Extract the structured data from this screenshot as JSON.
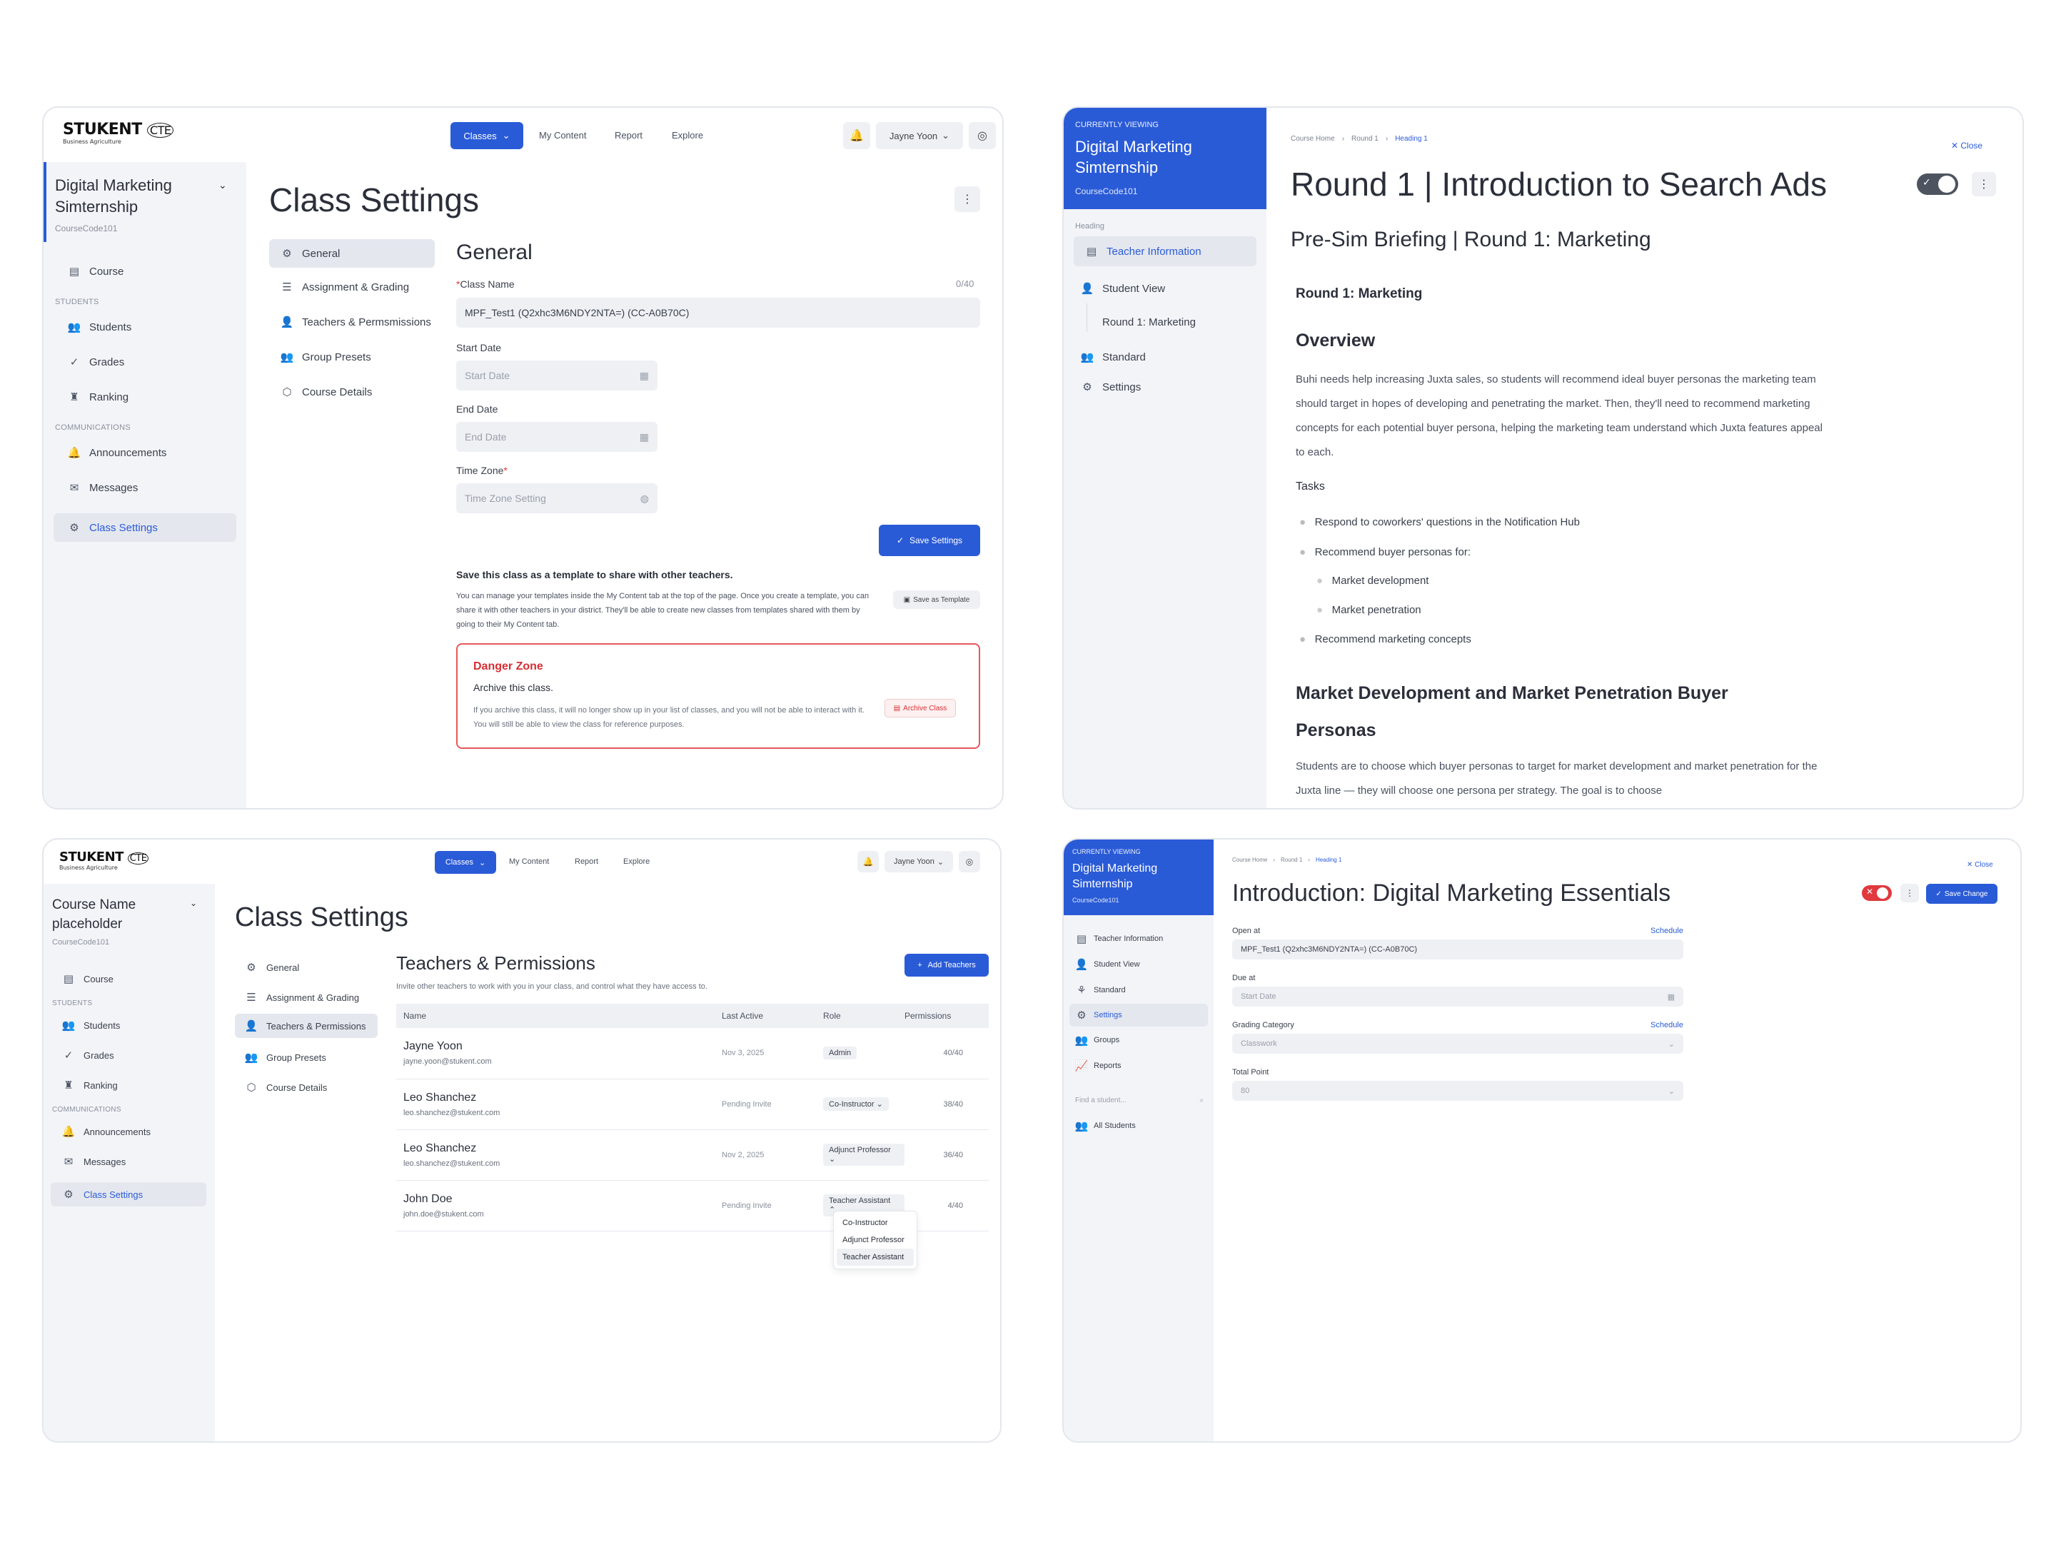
{
  "brand": {
    "name": "STUKENT",
    "suffix": "CTE",
    "tagline": "Business Agriculture"
  },
  "topnav": {
    "classes": "Classes",
    "my_content": "My Content",
    "report": "Report",
    "explore": "Explore",
    "user": "Jayne Yoon"
  },
  "sidebar": {
    "course_title": "Digital Marketing Simternship",
    "course_code": "CourseCode101",
    "course": "Course",
    "students_section": "STUDENTS",
    "students": "Students",
    "grades": "Grades",
    "ranking": "Ranking",
    "communications_section": "COMMUNICATIONS",
    "announcements": "Announcements",
    "messages": "Messages",
    "class_settings": "Class Settings"
  },
  "settings": {
    "title": "Class Settings",
    "menu": [
      "General",
      "Assignment & Grading",
      "Teachers & Permsmissions",
      "Group Presets",
      "Course Details"
    ],
    "general": {
      "heading": "General",
      "class_name_label": "Class Name",
      "class_name_count": "0/40",
      "class_name_value": "MPF_Test1 (Q2xhc3M6NDY2NTA=) (CC-A0B70C)",
      "start_label": "Start Date",
      "start_placeholder": "Start Date",
      "end_label": "End Date",
      "end_placeholder": "End Date",
      "tz_label": "Time Zone",
      "tz_placeholder": "Time Zone Setting",
      "save": "Save Settings",
      "template_heading": "Save this class as a template to share with other teachers.",
      "template_text": "You can manage your templates inside the My Content tab at the top of the page. Once you create a template, you can share it with other teachers in your district. They'll be able to create new classes from templates shared with them by going to their My Content tab.",
      "template_button": "Save as Template",
      "danger_title": "Danger Zone",
      "archive_heading": "Archive this class.",
      "archive_text": "If you archive this class, it will no longer show up in your list of classes, and you will not be able to interact with it. You will still be able to view the class for reference purposes.",
      "archive_button": "Archive Class"
    }
  },
  "viewer1": {
    "currently": "CURRENTLY VIEWING",
    "course": "Digital Marketing Simternship",
    "code": "CourseCode101",
    "nav_heading": "Heading",
    "nav": [
      "Teacher Information",
      "Student View",
      "Round 1: Marketing",
      "Standard",
      "Settings"
    ],
    "crumbs": [
      "Course Home",
      "Round 1",
      "Heading 1"
    ],
    "close": "Close",
    "title": "Round 1 | Introduction to Search Ads",
    "subtitle": "Pre-Sim Briefing | Round 1: Marketing",
    "section1": "Round 1: Marketing",
    "overview": "Overview",
    "overview_text": "Buhi needs help increasing Juxta sales, so students will recommend ideal buyer personas the marketing team should target in hopes of developing and penetrating the market. Then, they'll need to recommend marketing concepts for each potential buyer persona, helping the marketing team understand which Juxta features appeal to each.",
    "tasks": "Tasks",
    "task_items": [
      "Respond to coworkers' questions in the Notification Hub",
      "Recommend buyer personas for:",
      "Recommend marketing concepts"
    ],
    "sub_items": [
      "Market development",
      "Market penetration"
    ],
    "section2": "Market Development and Market Penetration Buyer Personas",
    "section2_text": "Students are to choose which buyer personas to target for market development and market penetration for the Juxta line — they will choose one persona per strategy. The goal is to choose"
  },
  "teachers": {
    "course_title": "Course Name placeholder",
    "course_code": "CourseCode101",
    "heading": "Teachers & Permissions",
    "desc": "Invite other teachers to work with you in your class, and control what they have access to.",
    "add": "Add Teachers",
    "menu": [
      "General",
      "Assignment & Grading",
      "Teachers & Permissions",
      "Group Presets",
      "Course Details"
    ],
    "cols": [
      "Name",
      "Last Active",
      "Role",
      "Permissions"
    ],
    "rows": [
      {
        "name": "Jayne Yoon",
        "email": "jayne.yoon@stukent.com",
        "last": "Nov 3, 2025",
        "role": "Admin",
        "perm": "40/40"
      },
      {
        "name": "Leo Shanchez",
        "email": "leo.shanchez@stukent.com",
        "last": "Pending Invite",
        "role": "Co-Instructor",
        "perm": "38/40"
      },
      {
        "name": "Leo Shanchez",
        "email": "leo.shanchez@stukent.com",
        "last": "Nov 2, 2025",
        "role": "Adjunct Professor",
        "perm": "36/40"
      },
      {
        "name": "John Doe",
        "email": "john.doe@stukent.com",
        "last": "Pending Invite",
        "role": "Teacher Assistant",
        "perm": "4/40"
      }
    ],
    "dropdown": [
      "Co-Instructor",
      "Adjunct Professor",
      "Teacher Assistant"
    ]
  },
  "viewer2": {
    "currently": "CURRENTLY VIEWING",
    "course": "Digital Marketing Simternship",
    "code": "CourseCode101",
    "nav": [
      "Teacher Information",
      "Student View",
      "Standard",
      "Settings",
      "Groups",
      "Reports"
    ],
    "search_placeholder": "Find a student...",
    "all_students": "All Students",
    "crumbs": [
      "Course Home",
      "Round 1",
      "Heading 1"
    ],
    "close": "Close",
    "title": "Introduction: Digital Marketing Essentials",
    "save": "Save Change",
    "open_label": "Open at",
    "schedule": "Schedule",
    "open_value": "MPF_Test1 (Q2xhc3M6NDY2NTA=) (CC-A0B70C)",
    "due_label": "Due at",
    "due_placeholder": "Start Date",
    "grading_label": "Grading Category",
    "grading_value": "Classwork",
    "total_label": "Total Point",
    "total_value": "80"
  },
  "colors": {
    "accent": "#2a5bd7",
    "danger": "#e0393e",
    "sidebar_bg": "#f2f4f8",
    "viewer_head": "#2a5bd7"
  }
}
